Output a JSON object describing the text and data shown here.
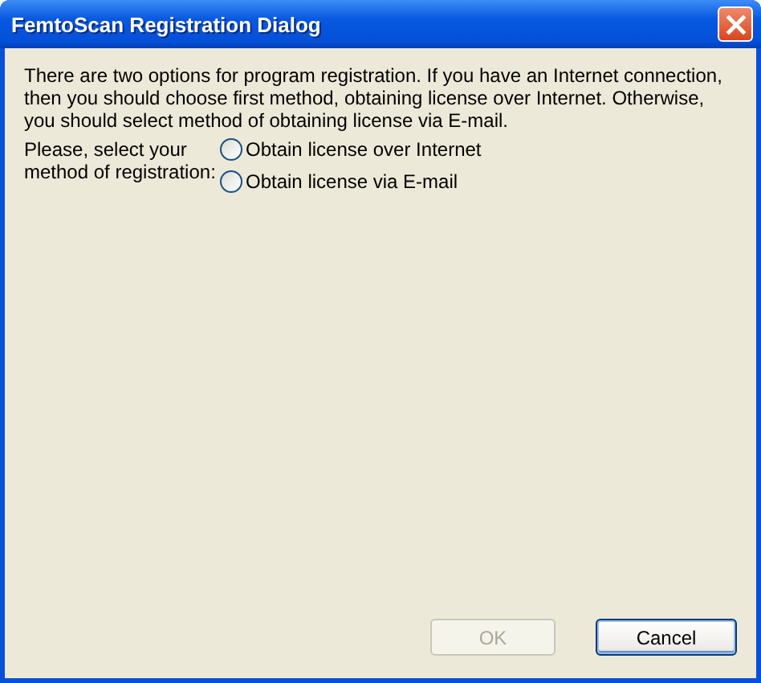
{
  "window": {
    "title": "FemtoScan Registration Dialog"
  },
  "description": "There are two options for program registration. If you have an Internet connection, then you should choose first method, obtaining license over Internet. Otherwise, you should select method of  obtaining license via E-mail.",
  "method_label": "Please, select your method of registration:",
  "options": [
    {
      "label": "Obtain license over Internet",
      "selected": false
    },
    {
      "label": "Obtain license via E-mail",
      "selected": false
    }
  ],
  "buttons": [
    {
      "label": "OK",
      "disabled": true,
      "default": false
    },
    {
      "label": "Cancel",
      "disabled": false,
      "default": true
    }
  ]
}
